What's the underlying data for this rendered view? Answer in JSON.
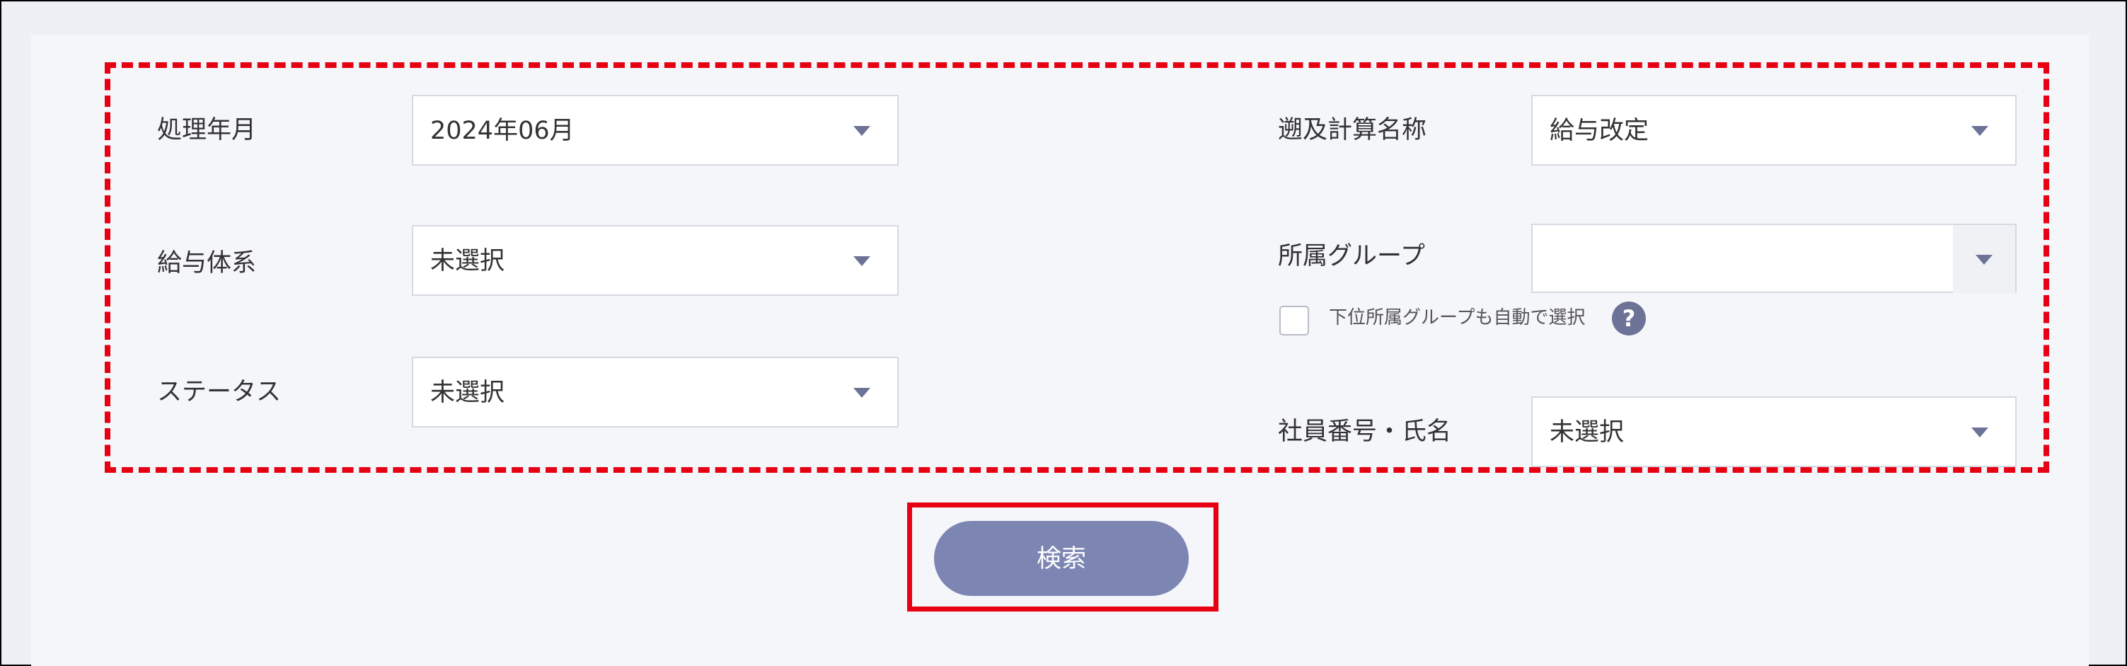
{
  "form": {
    "processing_month": {
      "label": "処理年月",
      "value": "2024年06月"
    },
    "pay_system": {
      "label": "給与体系",
      "value": "未選択"
    },
    "status": {
      "label": "ステータス",
      "value": "未選択"
    },
    "retro_calc_name": {
      "label": "遡及計算名称",
      "value": "給与改定"
    },
    "affiliation_group": {
      "label": "所属グループ",
      "value": "",
      "auto_select_label": "下位所属グループも自動で選択",
      "auto_select_checked": false,
      "help_symbol": "?"
    },
    "employee": {
      "label": "社員番号・氏名",
      "value": "未選択"
    }
  },
  "search_button": {
    "label": "検索"
  },
  "colors": {
    "highlight_red": "#e60012",
    "button_bg": "#7d86b3",
    "arrow": "#6c7396",
    "panel_bg": "#f5f6fa"
  }
}
